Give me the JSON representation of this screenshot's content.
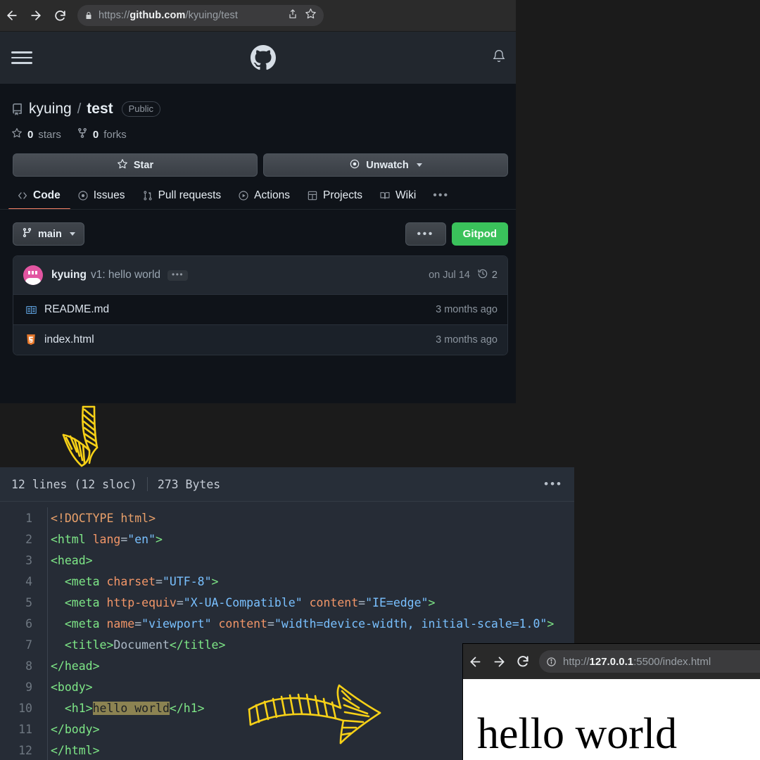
{
  "browser": {
    "back_icon": "back-arrow-icon",
    "forward_icon": "forward-arrow-icon",
    "reload_icon": "reload-icon",
    "lock_icon": "lock-icon",
    "url_scheme": "https://",
    "url_host": "github.com",
    "url_path": "/kyuing/test",
    "share_icon": "share-icon",
    "bookmark_icon": "star-bookmark-icon"
  },
  "github": {
    "header": {
      "menu_icon": "hamburger-menu-icon",
      "logo_icon": "github-mark-icon",
      "notifications_icon": "bell-icon"
    },
    "repo": {
      "icon": "repo-icon",
      "owner": "kyuing",
      "separator": "/",
      "name": "test",
      "visibility": "Public"
    },
    "stats": [
      {
        "icon": "star-icon",
        "count": "0",
        "label": "stars"
      },
      {
        "icon": "fork-icon",
        "count": "0",
        "label": "forks"
      }
    ],
    "actions": {
      "star_label": "Star",
      "watch_label": "Unwatch"
    },
    "nav": {
      "tabs": [
        {
          "label": "Code",
          "icon": "code-icon",
          "active": true
        },
        {
          "label": "Issues",
          "icon": "issue-opened-icon",
          "active": false
        },
        {
          "label": "Pull requests",
          "icon": "git-pull-request-icon",
          "active": false
        },
        {
          "label": "Actions",
          "icon": "play-icon",
          "active": false
        },
        {
          "label": "Projects",
          "icon": "table-icon",
          "active": false
        },
        {
          "label": "Wiki",
          "icon": "book-icon",
          "active": false
        }
      ],
      "overflow": "•••"
    },
    "branch": {
      "name": "main",
      "icon": "git-branch-icon",
      "kebab": "•••",
      "gitpod_label": "Gitpod"
    },
    "commit": {
      "author": "kyuing",
      "message": "v1: hello world",
      "expand": "•••",
      "date": "on Jul 14",
      "history_icon": "history-icon",
      "history_count": "2"
    },
    "files": [
      {
        "name": "README.md",
        "icon": "markdown-file-icon",
        "time": "3 months ago"
      },
      {
        "name": "index.html",
        "icon": "html5-file-icon",
        "time": "3 months ago"
      }
    ]
  },
  "code_panel": {
    "lines_label": "12 lines (12 sloc)",
    "size_label": "273 Bytes",
    "kebab": "•••",
    "lines": [
      {
        "n": "1",
        "text": "<!DOCTYPE html>"
      },
      {
        "n": "2",
        "text": "<html lang=\"en\">"
      },
      {
        "n": "3",
        "text": "<head>"
      },
      {
        "n": "4",
        "text": "  <meta charset=\"UTF-8\">"
      },
      {
        "n": "5",
        "text": "  <meta http-equiv=\"X-UA-Compatible\" content=\"IE=edge\">"
      },
      {
        "n": "6",
        "text": "  <meta name=\"viewport\" content=\"width=device-width, initial-scale=1.0\">"
      },
      {
        "n": "7",
        "text": "  <title>Document</title>"
      },
      {
        "n": "8",
        "text": "</head>"
      },
      {
        "n": "9",
        "text": "<body>"
      },
      {
        "n": "10",
        "text": "  <h1>hello world</h1>"
      },
      {
        "n": "11",
        "text": "</body>"
      },
      {
        "n": "12",
        "text": "</html>"
      }
    ],
    "highlighted_text": "hello world"
  },
  "preview": {
    "back_icon": "back-arrow-icon",
    "forward_icon": "forward-arrow-icon",
    "reload_icon": "reload-icon",
    "info_icon": "info-icon",
    "url_scheme": "http://",
    "url_host": "127.0.0.1",
    "url_path": ":5500/index.html",
    "page_heading": "hello world"
  },
  "annotations": {
    "arrow_down": "hand-drawn-down-arrow",
    "arrow_right": "hand-drawn-right-arrow",
    "color": "#F7D117"
  }
}
